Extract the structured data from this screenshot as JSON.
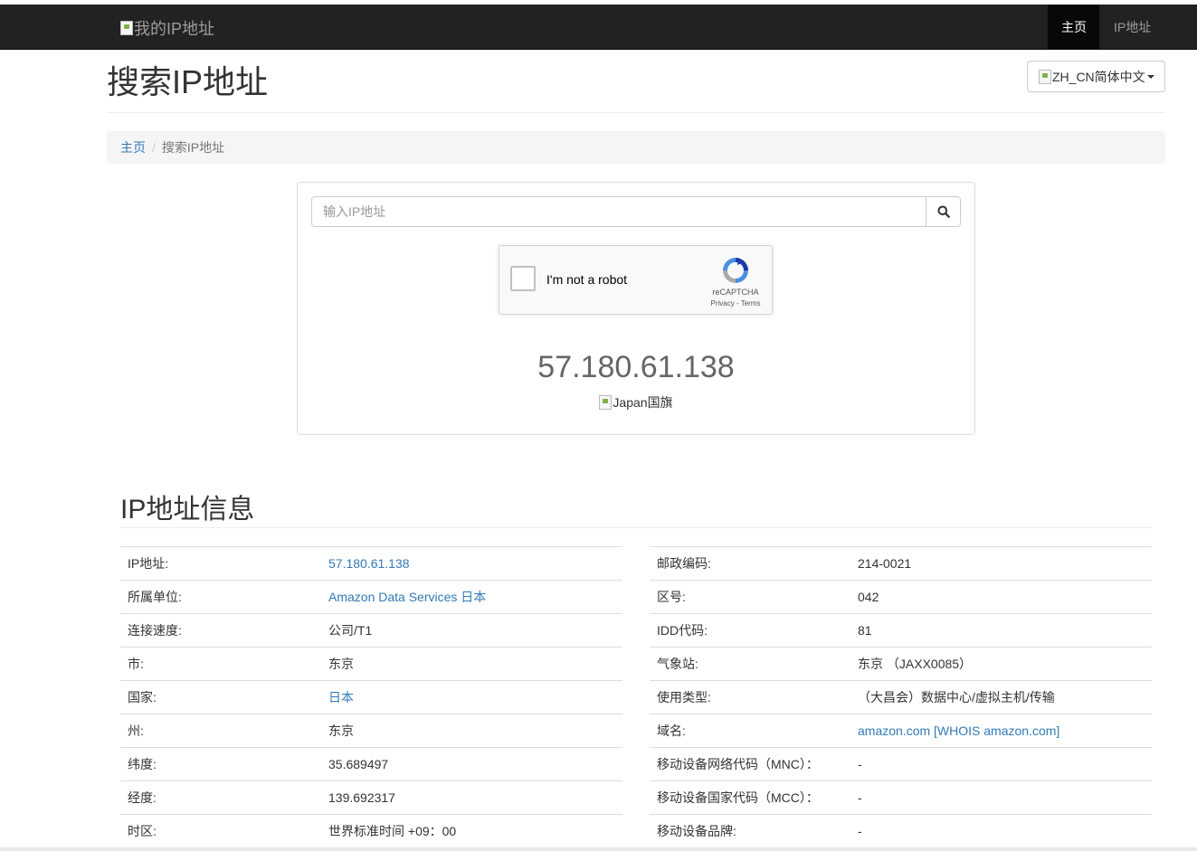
{
  "navbar": {
    "brand_alt": "我的IP地址",
    "items": [
      {
        "label": "主页",
        "active": true
      },
      {
        "label": "IP地址",
        "active": false
      }
    ]
  },
  "header": {
    "title": "搜索IP地址",
    "language_button": "ZH_CN简体中文"
  },
  "breadcrumb": {
    "home": "主页",
    "separator": "/",
    "current": "搜索IP地址"
  },
  "search": {
    "placeholder": "输入IP地址",
    "button_icon": "search-icon"
  },
  "recaptcha": {
    "label": "I'm not a robot",
    "brand": "reCAPTCHA",
    "links": "Privacy - Terms"
  },
  "result": {
    "ip": "57.180.61.138",
    "flag_alt": "Japan国旗"
  },
  "info": {
    "title": "IP地址信息",
    "left_rows": [
      {
        "key": "IP地址:",
        "value": "57.180.61.138",
        "link": true
      },
      {
        "key": "所属单位:",
        "value": "Amazon Data Services 日本",
        "link": true
      },
      {
        "key": "连接速度:",
        "value": "公司/T1",
        "link": false
      },
      {
        "key": "市:",
        "value": "东京",
        "link": false
      },
      {
        "key": "国家:",
        "value": "日本",
        "link": true
      },
      {
        "key": "州:",
        "value": "东京",
        "link": false
      },
      {
        "key": "纬度:",
        "value": "35.689497",
        "link": false
      },
      {
        "key": "经度:",
        "value": "139.692317",
        "link": false
      },
      {
        "key": "时区:",
        "value": "世界标准时间 +09：00",
        "link": false
      }
    ],
    "right_rows": [
      {
        "key": "邮政编码:",
        "value": "214-0021",
        "link": false
      },
      {
        "key": "区号:",
        "value": "042",
        "link": false
      },
      {
        "key": "IDD代码:",
        "value": "81",
        "link": false
      },
      {
        "key": "气象站:",
        "value": "东京 （JAXX0085）",
        "link": false
      },
      {
        "key": "使用类型:",
        "value": "（大昌会）数据中心/虚拟主机/传输",
        "link": false
      },
      {
        "key": "域名:",
        "value": "amazon.com [WHOIS amazon.com]",
        "link": true
      },
      {
        "key": "移动设备网络代码（MNC）：",
        "value": "-",
        "link": false
      },
      {
        "key": "移动设备国家代码（MCC）：",
        "value": "-",
        "link": false
      },
      {
        "key": "移动设备品牌:",
        "value": "-",
        "link": false
      }
    ]
  },
  "colors": {
    "navbar_bg": "#222222",
    "link": "#337ab7",
    "breadcrumb_bg": "#f5f5f5",
    "ip_text": "#666666"
  }
}
